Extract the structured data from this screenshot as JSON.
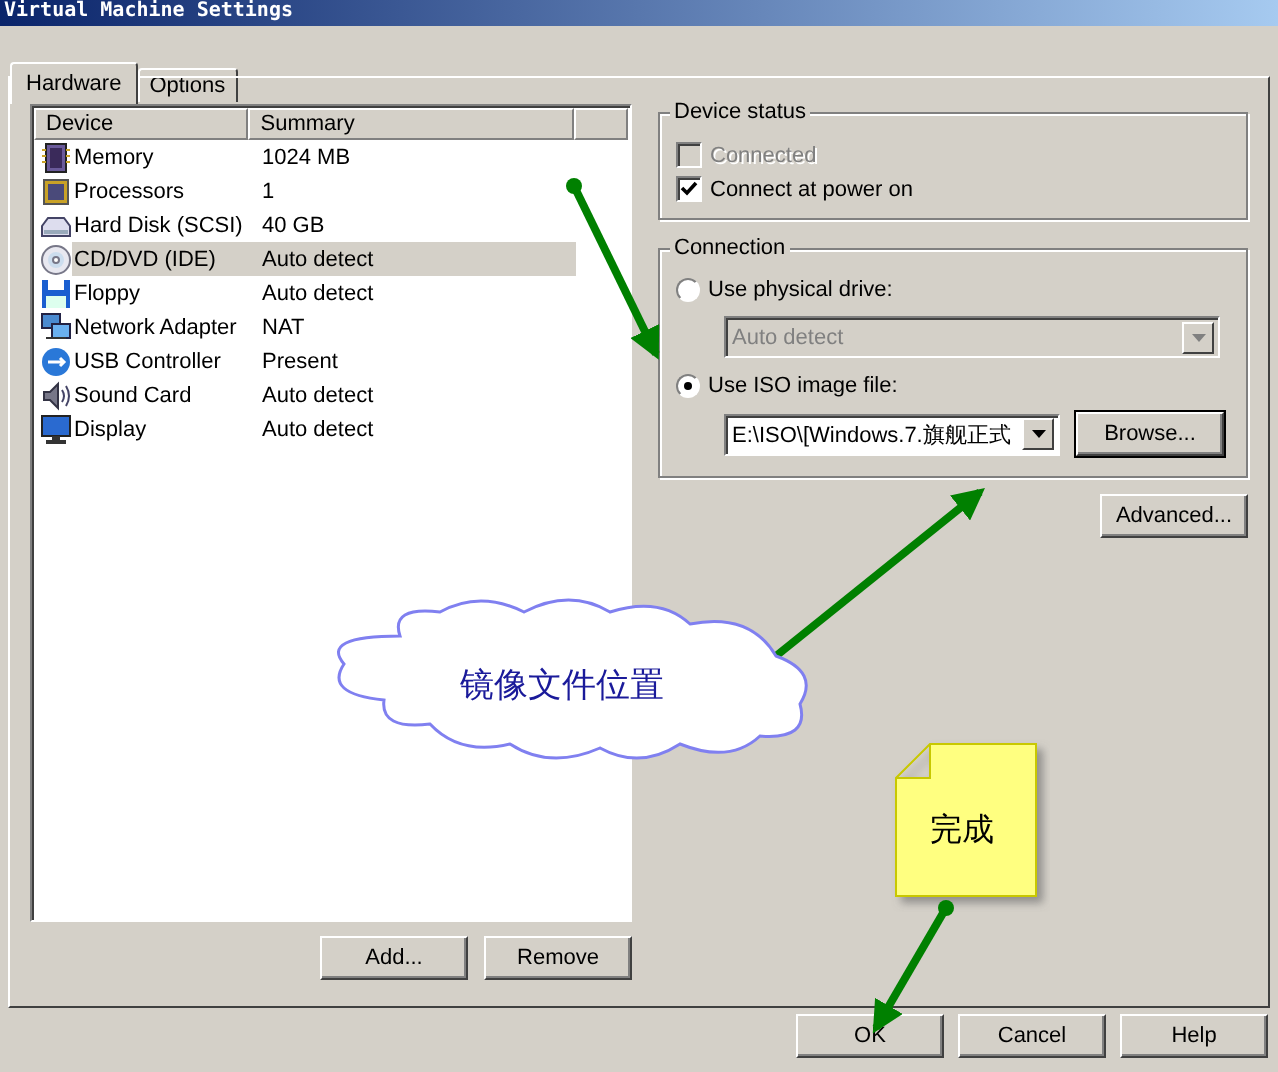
{
  "window": {
    "title": "Virtual Machine Settings"
  },
  "tabs": [
    {
      "label": "Hardware",
      "selected": true
    },
    {
      "label": "Options",
      "selected": false
    }
  ],
  "device_list": {
    "columns": [
      "Device",
      "Summary"
    ],
    "rows": [
      {
        "kind": "memory",
        "device": "Memory",
        "summary": "1024 MB",
        "selected": false
      },
      {
        "kind": "cpu",
        "device": "Processors",
        "summary": "1",
        "selected": false
      },
      {
        "kind": "disk",
        "device": "Hard Disk (SCSI)",
        "summary": "40 GB",
        "selected": false
      },
      {
        "kind": "cd",
        "device": "CD/DVD (IDE)",
        "summary": "Auto detect",
        "selected": true
      },
      {
        "kind": "floppy",
        "device": "Floppy",
        "summary": "Auto detect",
        "selected": false
      },
      {
        "kind": "network",
        "device": "Network Adapter",
        "summary": "NAT",
        "selected": false
      },
      {
        "kind": "usb",
        "device": "USB Controller",
        "summary": "Present",
        "selected": false
      },
      {
        "kind": "sound",
        "device": "Sound Card",
        "summary": "Auto detect",
        "selected": false
      },
      {
        "kind": "display",
        "device": "Display",
        "summary": "Auto detect",
        "selected": false
      }
    ]
  },
  "list_buttons": [
    "Add...",
    "Remove"
  ],
  "device_status": {
    "title": "Device status",
    "options": [
      {
        "label": "Connected",
        "checked": false,
        "disabled": true
      },
      {
        "label": "Connect at power on",
        "checked": true,
        "disabled": false
      }
    ]
  },
  "connection": {
    "title": "Connection",
    "options": [
      {
        "label": "Use physical drive:",
        "selected": false,
        "field": {
          "value": "Auto detect",
          "disabled": true
        }
      },
      {
        "label": "Use ISO image file:",
        "selected": true,
        "field": {
          "value": "E:\\ISO\\[Windows.7.旗舰正式",
          "disabled": false
        },
        "button": "Browse..."
      }
    ]
  },
  "advanced_button": "Advanced...",
  "annotations": [
    {
      "kind": "cloud",
      "text": "镜像文件位置"
    },
    {
      "kind": "note",
      "text": "完成"
    }
  ],
  "dialog_buttons": [
    "OK",
    "Cancel",
    "Help"
  ]
}
